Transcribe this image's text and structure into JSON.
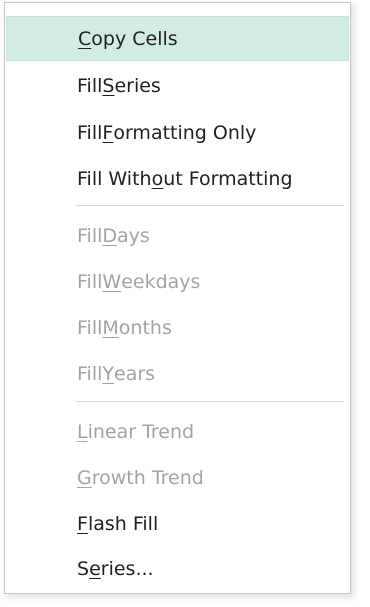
{
  "menu": {
    "items": [
      {
        "parts": [
          "",
          "C",
          "opy Cells"
        ],
        "state": "highlighted"
      },
      {
        "parts": [
          "Fill ",
          "S",
          "eries"
        ],
        "state": "enabled"
      },
      {
        "parts": [
          "Fill ",
          "F",
          "ormatting Only"
        ],
        "state": "enabled"
      },
      {
        "parts": [
          "Fill With",
          "o",
          "ut Formatting"
        ],
        "state": "enabled"
      },
      {
        "parts": [
          "Fill ",
          "D",
          "ays"
        ],
        "state": "disabled"
      },
      {
        "parts": [
          "Fill ",
          "W",
          "eekdays"
        ],
        "state": "disabled"
      },
      {
        "parts": [
          "Fill ",
          "M",
          "onths"
        ],
        "state": "disabled"
      },
      {
        "parts": [
          "Fill ",
          "Y",
          "ears"
        ],
        "state": "disabled"
      },
      {
        "parts": [
          "",
          "L",
          "inear Trend"
        ],
        "state": "disabled"
      },
      {
        "parts": [
          "",
          "G",
          "rowth Trend"
        ],
        "state": "disabled"
      },
      {
        "parts": [
          "",
          "F",
          "lash Fill"
        ],
        "state": "enabled"
      },
      {
        "parts": [
          "S",
          "e",
          "ries..."
        ],
        "state": "enabled"
      }
    ]
  }
}
